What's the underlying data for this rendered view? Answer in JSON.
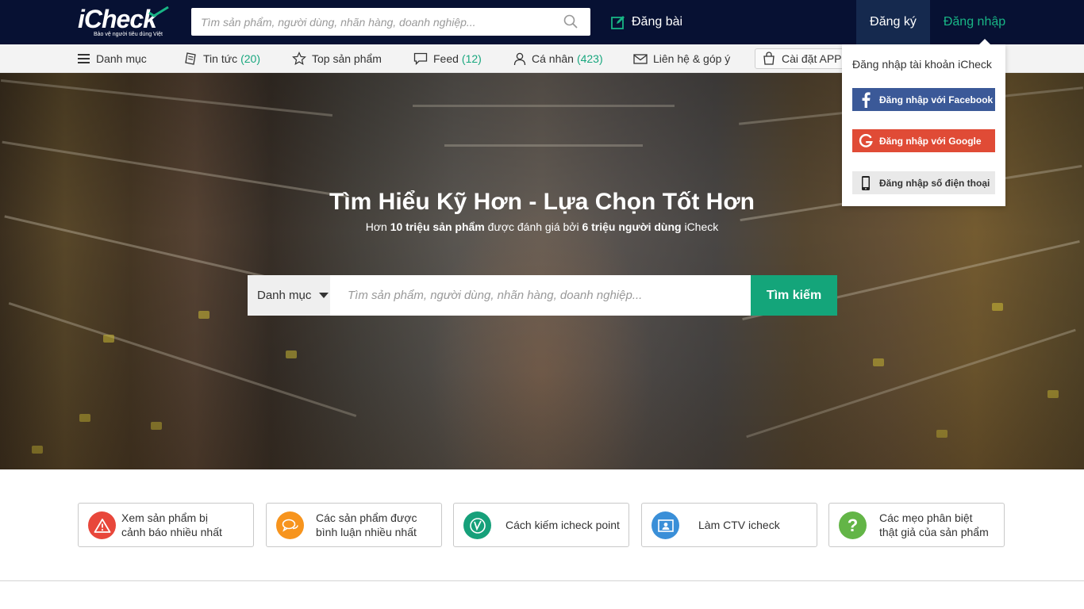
{
  "brand": {
    "logo_text": "iCheck",
    "tagline": "Bảo vệ người tiêu dùng Việt"
  },
  "header": {
    "search_placeholder": "Tìm sản phẩm, người dùng, nhãn hàng, doanh nghiệp...",
    "post_label": "Đăng bài",
    "register_label": "Đăng ký",
    "login_label": "Đăng nhập"
  },
  "nav": {
    "menu_label": "Danh mục",
    "news_label": "Tin tức",
    "news_count": "(20)",
    "top_label": "Top sản phẩm",
    "feed_label": "Feed",
    "feed_count": "(12)",
    "personal_label": "Cá nhân",
    "personal_count": "(423)",
    "contact_label": "Liên hệ & góp ý",
    "app_label": "Cài đặt APP i"
  },
  "hero": {
    "title": "Tìm Hiểu Kỹ Hơn - Lựa Chọn Tốt Hơn",
    "sub_1": "Hơn",
    "sub_2": "10 triệu sản phẩm",
    "sub_3": "được đánh giá bởi",
    "sub_4": "6 triệu người dùng",
    "sub_5": "iCheck",
    "category_label": "Danh mục",
    "search_placeholder": "Tìm sản phẩm, người dùng, nhãn hàng, doanh nghiệp...",
    "search_button": "Tìm kiếm"
  },
  "cards": [
    {
      "line1": "Xem sản phẩm bị",
      "line2": "cảnh báo nhiều nhất",
      "color": "#e8473b",
      "icon": "warning-icon"
    },
    {
      "line1": "Các sản phẩm được",
      "line2": "bình luận nhiều nhất",
      "color": "#f7941d",
      "icon": "chat-icon"
    },
    {
      "line1": "Cách kiếm icheck point",
      "color": "#16a07a",
      "icon": "point-icon"
    },
    {
      "line1": "Làm CTV icheck",
      "color": "#3a8fd8",
      "icon": "id-card-icon"
    },
    {
      "line1": "Các mẹo phân biệt",
      "line2": "thật giả của sản phẩm",
      "color": "#63b547",
      "icon": "question-icon"
    }
  ],
  "login_dropdown": {
    "title": "Đăng nhập tài khoản iCheck",
    "facebook_label": "Đăng nhập với Facebook",
    "google_label": "Đăng nhập với Google",
    "phone_label": "Đăng nhập số điện thoại"
  },
  "colors": {
    "topbar": "#071133",
    "accent_green": "#14a57a",
    "facebook": "#3b5998",
    "google": "#e04b36"
  }
}
